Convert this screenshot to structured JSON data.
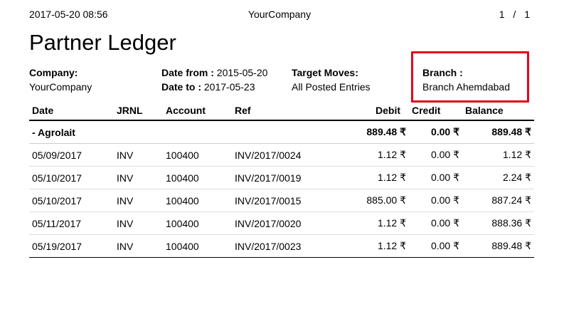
{
  "header": {
    "datetime": "2017-05-20 08:56",
    "company": "YourCompany",
    "pager": "1 / 1"
  },
  "title": "Partner Ledger",
  "info": {
    "company_label": "Company:",
    "company_value": "YourCompany",
    "date_from_label": "Date from :",
    "date_from_value": "2015-05-20",
    "date_to_label": "Date to :",
    "date_to_value": "2017-05-23",
    "target_label": "Target Moves:",
    "target_value": "All Posted Entries",
    "branch_label": "Branch :",
    "branch_value": "Branch Ahemdabad"
  },
  "highlight_color": "#e3001b",
  "table": {
    "columns": [
      "Date",
      "JRNL",
      "Account",
      "Ref",
      "Debit",
      "Credit",
      "Balance"
    ],
    "group": {
      "name": "- Agrolait",
      "debit": "889.48 ₹",
      "credit": "0.00 ₹",
      "balance": "889.48 ₹"
    },
    "rows": [
      {
        "date": "05/09/2017",
        "jrnl": "INV",
        "account": "100400",
        "ref": "INV/2017/0024",
        "debit": "1.12 ₹",
        "credit": "0.00 ₹",
        "balance": "1.12 ₹"
      },
      {
        "date": "05/10/2017",
        "jrnl": "INV",
        "account": "100400",
        "ref": "INV/2017/0019",
        "debit": "1.12 ₹",
        "credit": "0.00 ₹",
        "balance": "2.24 ₹"
      },
      {
        "date": "05/10/2017",
        "jrnl": "INV",
        "account": "100400",
        "ref": "INV/2017/0015",
        "debit": "885.00 ₹",
        "credit": "0.00 ₹",
        "balance": "887.24 ₹"
      },
      {
        "date": "05/11/2017",
        "jrnl": "INV",
        "account": "100400",
        "ref": "INV/2017/0020",
        "debit": "1.12 ₹",
        "credit": "0.00 ₹",
        "balance": "888.36 ₹"
      },
      {
        "date": "05/19/2017",
        "jrnl": "INV",
        "account": "100400",
        "ref": "INV/2017/0023",
        "debit": "1.12 ₹",
        "credit": "0.00 ₹",
        "balance": "889.48 ₹"
      }
    ]
  }
}
